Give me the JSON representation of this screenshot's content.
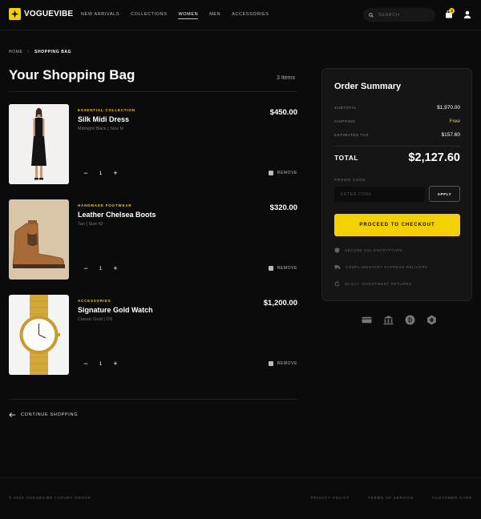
{
  "brand": {
    "name": "VOGUEVIBE",
    "accent": "#f5d000"
  },
  "nav": [
    {
      "label": "NEW ARRIVALS",
      "active": false
    },
    {
      "label": "COLLECTIONS",
      "active": false
    },
    {
      "label": "WOMEN",
      "active": true
    },
    {
      "label": "MEN",
      "active": false
    },
    {
      "label": "ACCESSORIES",
      "active": false
    }
  ],
  "search": {
    "placeholder": "SEARCH",
    "icon": "search-icon"
  },
  "cart": {
    "count": "3",
    "icon": "shopping-bag-icon"
  },
  "account": {
    "icon": "user-icon"
  },
  "breadcrumb": {
    "home": "HOME",
    "separator": "›",
    "current": "SHOPPING BAG"
  },
  "page": {
    "title": "Your Shopping Bag",
    "item_count": "3 Items"
  },
  "items": [
    {
      "category": "ESSENTIAL COLLECTION",
      "name": "Silk Midi Dress",
      "variant": "Midnight Black | Size M",
      "price": "$450.00",
      "quantity": "1",
      "decrement": "−",
      "increment": "+",
      "remove": "REMOVE"
    },
    {
      "category": "HANDMADE FOOTWEAR",
      "name": "Leather Chelsea Boots",
      "variant": "Tan | Size 42",
      "price": "$320.00",
      "quantity": "1",
      "decrement": "−",
      "increment": "+",
      "remove": "REMOVE"
    },
    {
      "category": "ACCESSORIES",
      "name": "Signature Gold Watch",
      "variant": "Classic Gold | OS",
      "price": "$1,200.00",
      "quantity": "1",
      "decrement": "−",
      "increment": "+",
      "remove": "REMOVE"
    }
  ],
  "continue_shopping": "CONTINUE SHOPPING",
  "summary": {
    "title": "Order Summary",
    "subtotal_label": "SUBTOTAL",
    "subtotal": "$1,970.00",
    "shipping_label": "SHIPPING",
    "shipping": "Free",
    "tax_label": "ESTIMATED TAX",
    "tax": "$157.60",
    "total_label": "TOTAL",
    "total": "$2,127.60",
    "promo_label": "PROMO CODE",
    "promo_placeholder": "ENTER CODE",
    "apply": "APPLY",
    "checkout": "PROCEED TO CHECKOUT",
    "assurances": [
      {
        "icon": "shield-icon",
        "text": "SECURE SSL ENCRYPTION"
      },
      {
        "icon": "truck-icon",
        "text": "COMPLIMENTARY EXPRESS DELIVERY"
      },
      {
        "icon": "refresh-icon",
        "text": "30-DAY INVESTMENT RETURNS"
      }
    ]
  },
  "payment_icons": [
    "credit-card-icon",
    "bank-icon",
    "bitcoin-icon",
    "crypto-icon"
  ],
  "footer": {
    "copyright": "© 2024 VOGUEVIBE LUXURY GROUP",
    "links": [
      "PRIVACY POLICY",
      "TERMS OF SERVICE",
      "CUSTOMER CARE"
    ]
  }
}
